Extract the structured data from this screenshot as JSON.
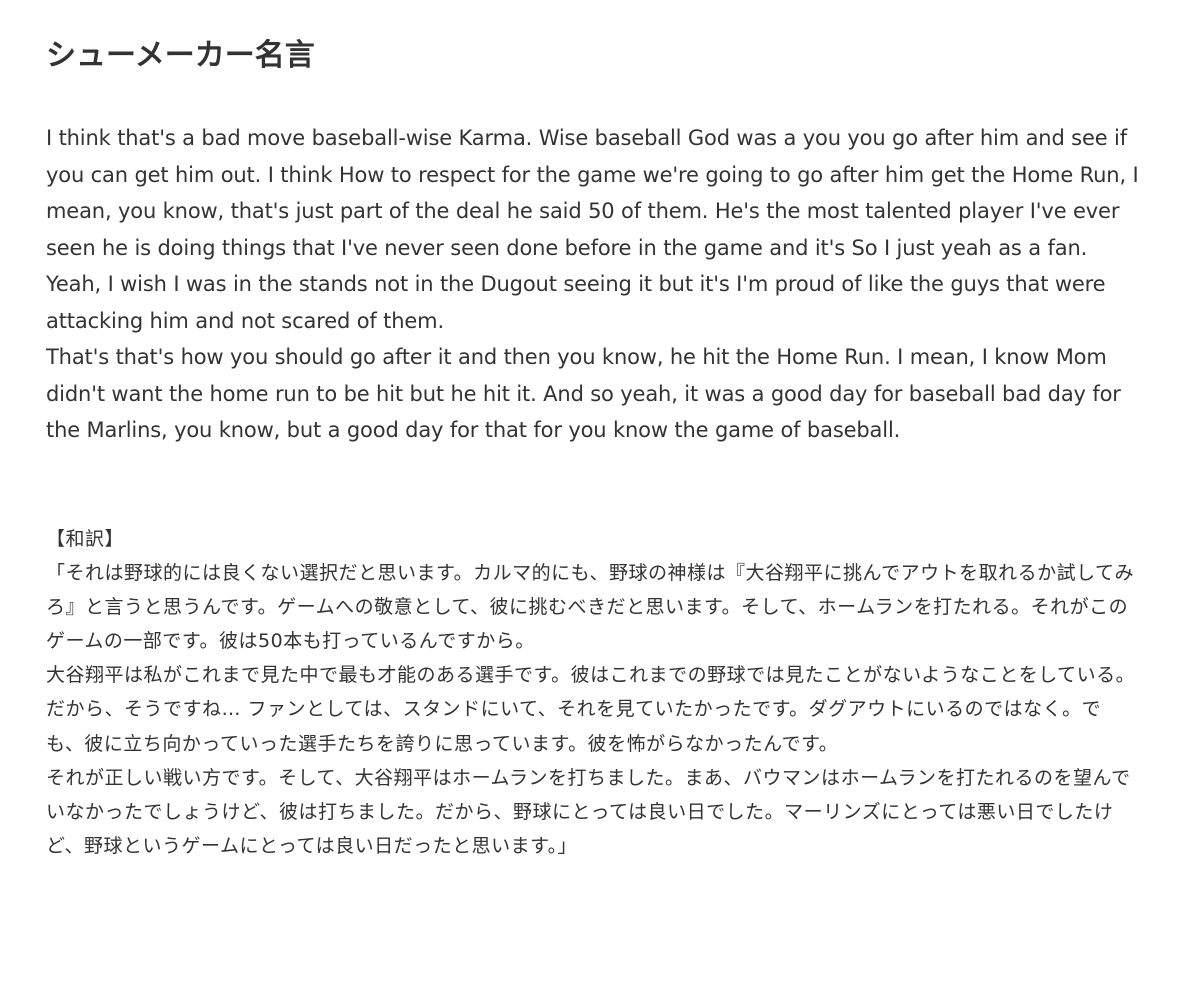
{
  "title": "シューメーカー名言",
  "english": {
    "paragraphs": [
      "I think that's a bad move baseball-wise Karma. Wise baseball God was a you you go after him and see if you can get him out. I think How to respect for the game we're going to go after him get the Home Run, I mean, you know, that's just part of the deal he said 50 of them. He's the most talented player I've ever seen he is doing things that I've never seen done before in the game and it's So I just yeah as a fan. Yeah, I wish I was in the stands not in the Dugout seeing it but it's I'm proud of like the guys that were attacking him and not scared of them.",
      "That's that's how you should go after it and then you know, he hit the Home Run. I mean, I know Mom didn't want the home run to be hit but he hit it. And so yeah, it was a good day for baseball bad day for the Marlins, you know, but a good day for that for you know the game of baseball."
    ]
  },
  "japanese": {
    "heading": "【和訳】",
    "paragraphs": [
      "「それは野球的には良くない選択だと思います。カルマ的にも、野球の神様は『大谷翔平に挑んでアウトを取れるか試してみろ』と言うと思うんです。ゲームへの敬意として、彼に挑むべきだと思います。そして、ホームランを打たれる。それがこのゲームの一部です。彼は50本も打っているんですから。",
      "大谷翔平は私がこれまで見た中で最も才能のある選手です。彼はこれまでの野球では見たことがないようなことをしている。だから、そうですね… ファンとしては、スタンドにいて、それを見ていたかったです。ダグアウトにいるのではなく。でも、彼に立ち向かっていった選手たちを誇りに思っています。彼を怖がらなかったんです。",
      "それが正しい戦い方です。そして、大谷翔平はホームランを打ちました。まあ、バウマンはホームランを打たれるのを望んでいなかったでしょうけど、彼は打ちました。だから、野球にとっては良い日でした。マーリンズにとっては悪い日でしたけど、野球というゲームにとっては良い日だったと思います。」"
    ]
  }
}
